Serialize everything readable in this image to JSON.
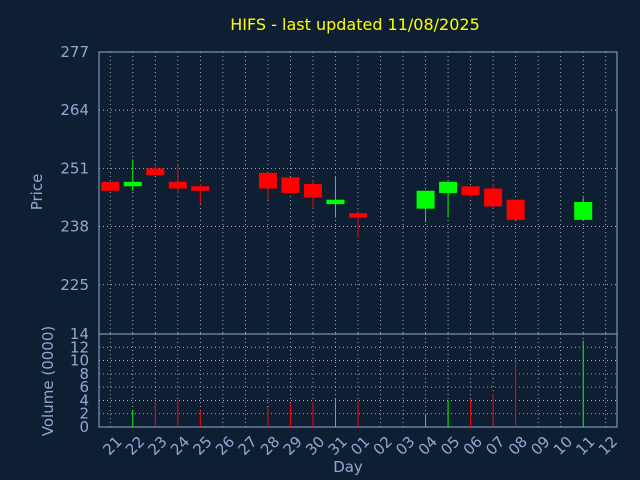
{
  "colors": {
    "background": "#0f1f33",
    "frame": "#8faad0",
    "grid": "#c8d2dc",
    "text": "#8faad0",
    "title": "#ffff00",
    "up": "#00ff00",
    "down": "#ff0000"
  },
  "chart_data": {
    "type": "candlestick",
    "title": "HIFS - last updated 11/08/2025",
    "xlabel": "Day",
    "price_panel": {
      "ylabel": "Price",
      "ylim": [
        214,
        277
      ],
      "yticks": [
        225,
        238,
        251,
        264,
        277
      ],
      "grid": true
    },
    "volume_panel": {
      "ylabel": "Volume (0000)",
      "ylim": [
        0,
        14
      ],
      "yticks": [
        0,
        2,
        4,
        6,
        8,
        10,
        12,
        14
      ],
      "grid": true
    },
    "x_tick_labels": [
      "21",
      "22",
      "23",
      "24",
      "25",
      "26",
      "27",
      "28",
      "29",
      "30",
      "31",
      "01",
      "02",
      "03",
      "04",
      "05",
      "06",
      "07",
      "08",
      "09",
      "10",
      "11",
      "12"
    ],
    "candles": [
      {
        "x": "21",
        "open": 248,
        "close": 246,
        "high": 248,
        "low": 246,
        "volume": 0
      },
      {
        "x": "22",
        "open": 247,
        "close": 248,
        "high": 253,
        "low": 246,
        "volume": 2.5
      },
      {
        "x": "23",
        "open": 251,
        "close": 249.5,
        "high": 251.5,
        "low": 249.5,
        "volume": 3.8
      },
      {
        "x": "24",
        "open": 248,
        "close": 246.5,
        "high": 252,
        "low": 245.5,
        "volume": 4
      },
      {
        "x": "25",
        "open": 247,
        "close": 246,
        "high": 247.5,
        "low": 243,
        "volume": 2.5
      },
      {
        "x": "28",
        "open": 250,
        "close": 246.5,
        "high": 250,
        "low": 244,
        "volume": 3
      },
      {
        "x": "29",
        "open": 249,
        "close": 245.5,
        "high": 249,
        "low": 245.5,
        "volume": 3.6
      },
      {
        "x": "30",
        "open": 247.5,
        "close": 244.5,
        "high": 248.5,
        "low": 242,
        "volume": 3.8
      },
      {
        "x": "31",
        "open": 243,
        "close": 244,
        "high": 249,
        "low": 240,
        "volume": 4.2
      },
      {
        "x": "01",
        "open": 241,
        "close": 240,
        "high": 241.5,
        "low": 235.5,
        "volume": 3.8
      },
      {
        "x": "04",
        "open": 242,
        "close": 246,
        "high": 246,
        "low": 239,
        "volume": 2
      },
      {
        "x": "05",
        "open": 245.5,
        "close": 248,
        "high": 248,
        "low": 240,
        "volume": 4
      },
      {
        "x": "06",
        "open": 247,
        "close": 245,
        "high": 247,
        "low": 244.5,
        "volume": 4.2
      },
      {
        "x": "07",
        "open": 246.5,
        "close": 242.5,
        "high": 247.5,
        "low": 242,
        "volume": 5
      },
      {
        "x": "08",
        "open": 244,
        "close": 239.5,
        "high": 244,
        "low": 239.5,
        "volume": 10
      },
      {
        "x": "11",
        "open": 239.5,
        "close": 243.5,
        "high": 244.5,
        "low": 239.5,
        "volume": 13
      }
    ]
  }
}
